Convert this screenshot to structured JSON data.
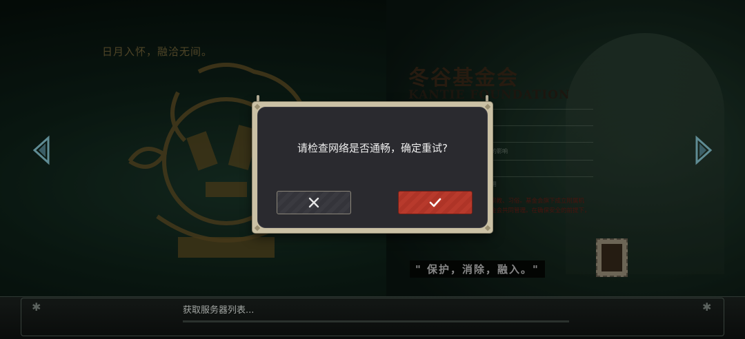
{
  "background": {
    "tagline": "日月入怀，融洽无间。",
    "foundation_title": "冬谷基金会",
    "foundation_subtitle": "KANTIE FOUNDATION",
    "fragments": [
      "的影响",
      "用"
    ],
    "description": "参与社会生活，了解现代文化、宗教、习俗。基金会旗下成立附属机构、公司等组织，由收藏家与基金会共同管理。在确保安全的前提下，推进收藏家与普通人的社会活动。",
    "motto": "\" 保护，消除，融入。\""
  },
  "dialog": {
    "message": "请检查网络是否通畅，确定重试?",
    "cancel_icon": "close-icon",
    "confirm_icon": "checkmark-icon"
  },
  "status": {
    "loading_text": "获取服务器列表...",
    "progress": 0.0
  },
  "colors": {
    "accent_red": "#b83a2c",
    "frame_beige": "#cbc1a5",
    "panel_dark": "#2a2a2f"
  }
}
